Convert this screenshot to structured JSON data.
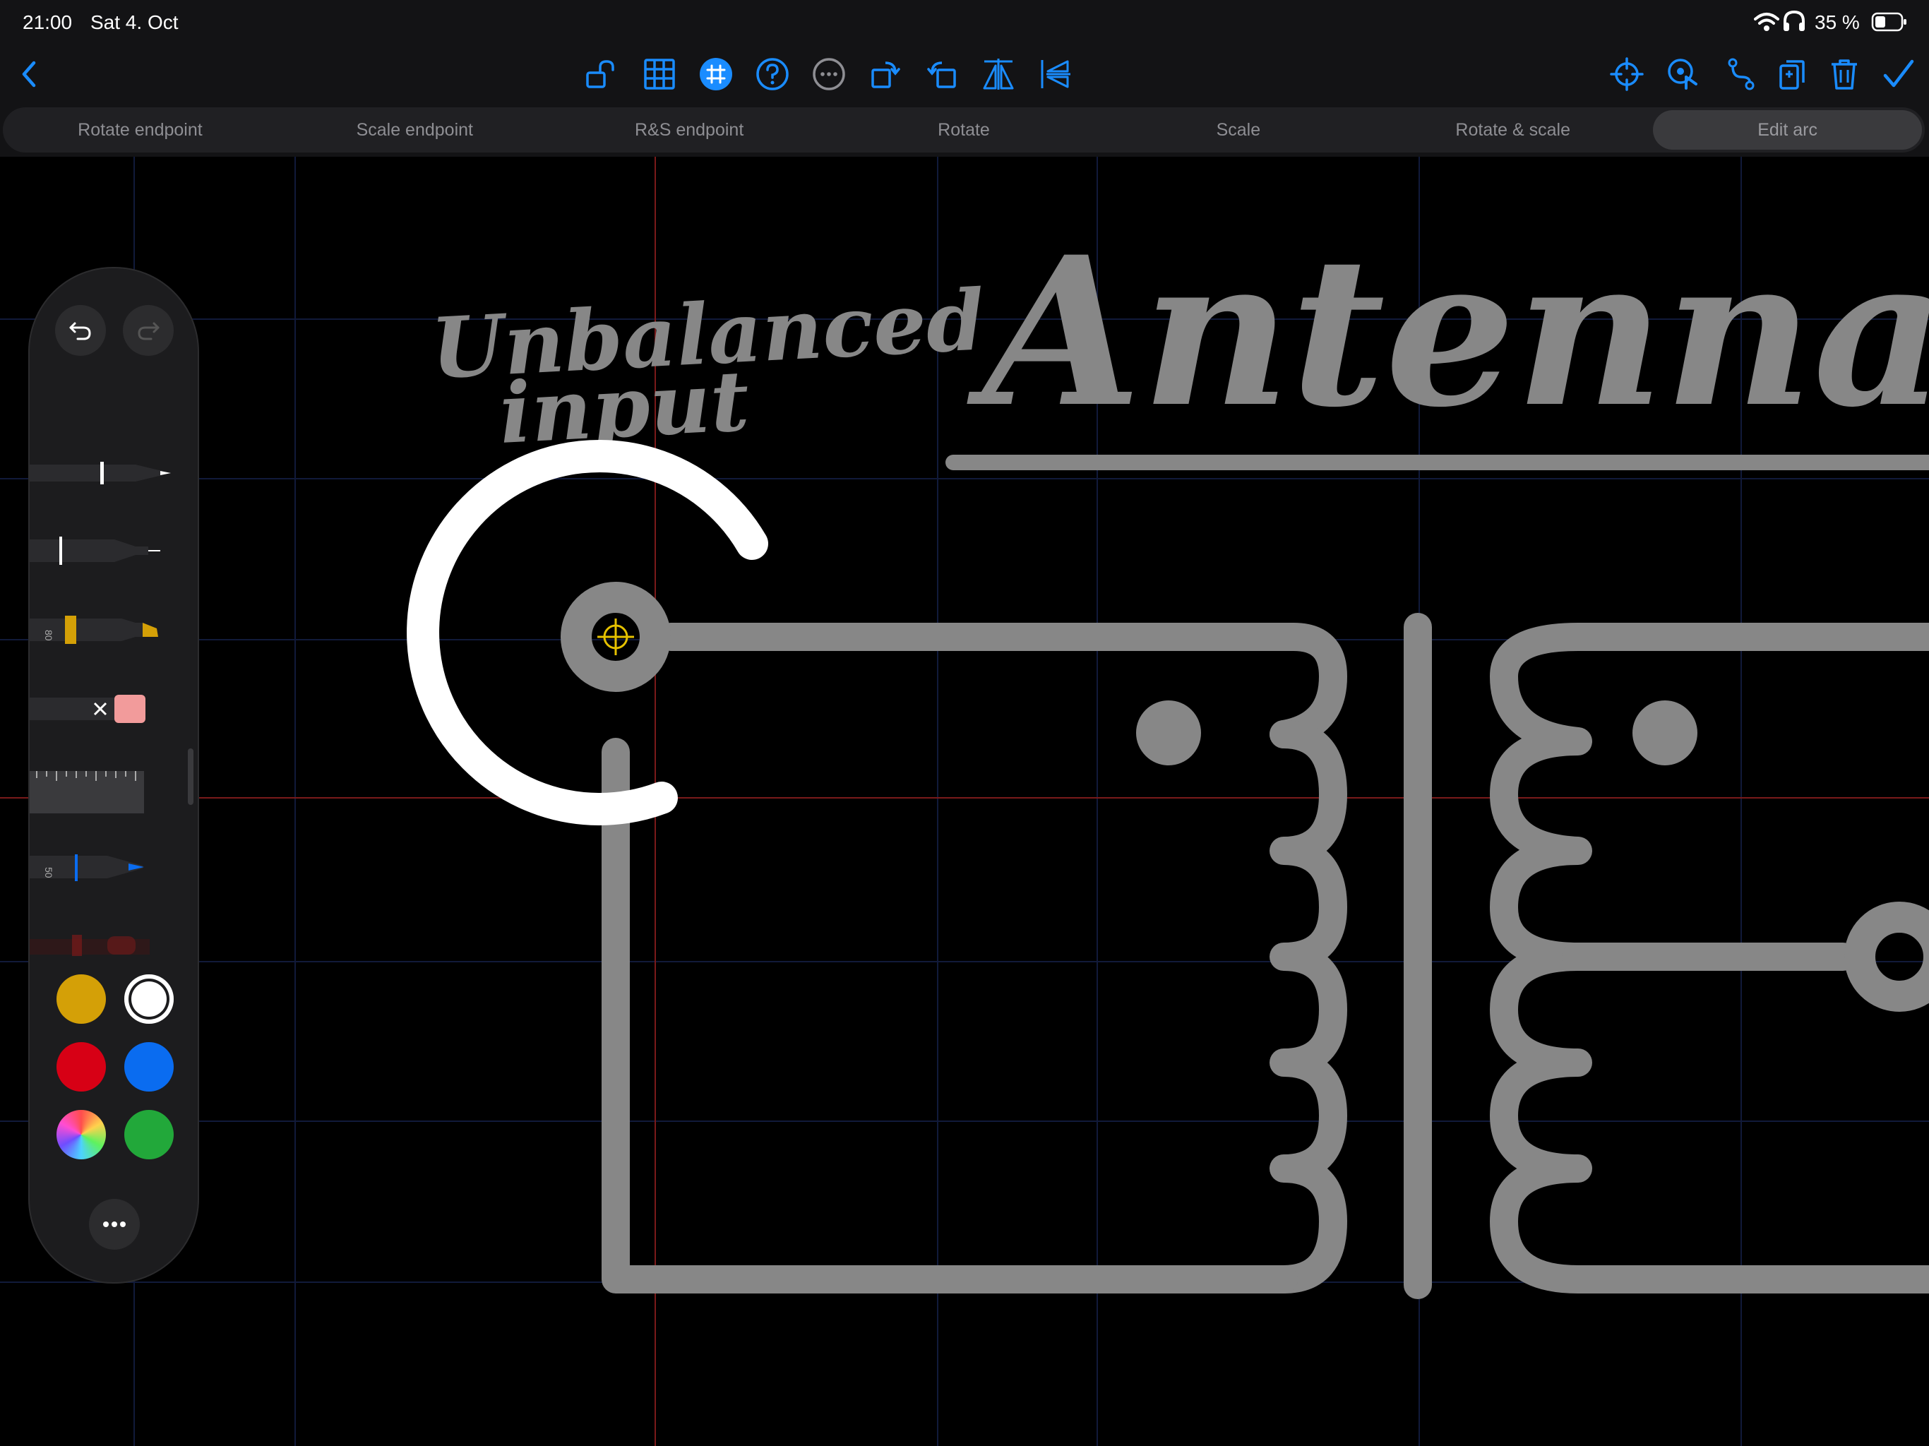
{
  "status": {
    "time": "21:00",
    "date": "Sat 4. Oct",
    "battery": "35 %"
  },
  "toolbar": {
    "accent": "#1a8cff",
    "left_icons": [
      "back-chevron-icon"
    ],
    "center_icons": [
      "lock-open-icon",
      "grid-icon",
      "snap-grid-icon",
      "help-icon",
      "more-icon",
      "rotate-right-icon",
      "rotate-left-icon",
      "flip-horizontal-icon",
      "flip-vertical-icon"
    ],
    "right_icons": [
      "crosshair-icon",
      "select-touch-icon",
      "path-icon",
      "duplicate-icon",
      "trash-icon",
      "checkmark-icon"
    ]
  },
  "modes": {
    "items": [
      {
        "label": "Rotate endpoint"
      },
      {
        "label": "Scale endpoint"
      },
      {
        "label": "R&S endpoint"
      },
      {
        "label": "Rotate"
      },
      {
        "label": "Scale"
      },
      {
        "label": "Rotate & scale"
      },
      {
        "label": "Edit arc"
      }
    ],
    "selected": "Edit arc"
  },
  "canvas": {
    "handwriting": {
      "line1": "Unbalanced",
      "line2": "input",
      "title": "Antenna"
    },
    "colors": {
      "ink": "#878787",
      "selection": "#ffffff",
      "grid": "#111a3a",
      "guide": "#7a1a1a",
      "handle": "#e5c100"
    }
  },
  "tools": {
    "items": [
      "pen",
      "fineliner",
      "marker",
      "eraser",
      "ruler",
      "pencil",
      "lasso"
    ],
    "marker_size": "80",
    "pencil_size": "50"
  },
  "palette": {
    "colors": [
      {
        "name": "yellow",
        "hex": "#d4a007"
      },
      {
        "name": "white",
        "hex": "#ffffff"
      },
      {
        "name": "red",
        "hex": "#d70015"
      },
      {
        "name": "blue",
        "hex": "#0a6cf0"
      },
      {
        "name": "multicolor",
        "hex": ""
      },
      {
        "name": "green",
        "hex": "#22a83a"
      }
    ],
    "selected": "white"
  }
}
